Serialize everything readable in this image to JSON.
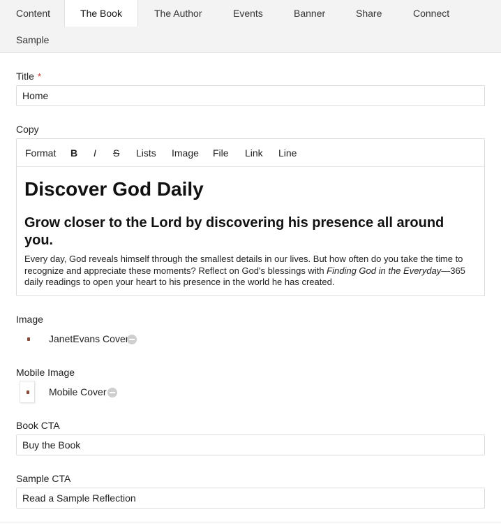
{
  "tabs": [
    {
      "label": "Content"
    },
    {
      "label": "The Book"
    },
    {
      "label": "The Author"
    },
    {
      "label": "Events"
    },
    {
      "label": "Banner"
    },
    {
      "label": "Share"
    },
    {
      "label": "Connect"
    },
    {
      "label": "Sample"
    }
  ],
  "active_tab": "The Book",
  "fields": {
    "title": {
      "label": "Title",
      "required_mark": "*",
      "value": "Home"
    },
    "copy": {
      "label": "Copy",
      "toolbar": [
        "Format",
        "B",
        "I",
        "S",
        "Lists",
        "Image",
        "File",
        "Link",
        "Line"
      ],
      "heading": "Discover God Daily",
      "subheading": "Grow closer to the Lord by discovering his presence all around you.",
      "body_before": "Every day, God reveals himself through the smallest details in our lives. But how often do you take the time to recognize and appreciate these moments? Reflect on God's blessings with ",
      "body_italic": "Finding God in the Everyday",
      "body_after": "—365 daily readings to open your heart to his presence in the world he has created."
    },
    "image": {
      "label": "Image",
      "file_name": "JanetEvans Cover",
      "remove_icon": "minus-circle-icon"
    },
    "mobile_image": {
      "label": "Mobile Image",
      "file_name": "Mobile Cover",
      "remove_icon": "minus-circle-icon"
    },
    "book_cta": {
      "label": "Book CTA",
      "value": "Buy the Book"
    },
    "sample_cta": {
      "label": "Sample CTA",
      "value": "Read a Sample Reflection"
    }
  },
  "colors": {
    "required": "#d0302b",
    "tab_bar": "#f3f3f3",
    "border": "#dcdcdc"
  }
}
